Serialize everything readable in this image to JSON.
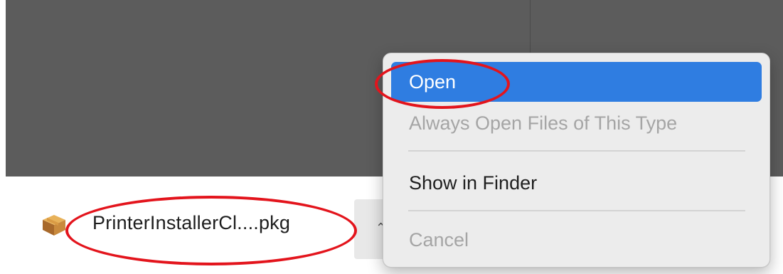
{
  "download_shelf": {
    "file_name": "PrinterInstallerCl....pkg",
    "file_icon": "package-box-icon",
    "options_icon": "chevron-up-icon"
  },
  "context_menu": {
    "items": [
      {
        "label": "Open",
        "state": "highlighted"
      },
      {
        "label": "Always Open Files of This Type",
        "state": "disabled"
      },
      {
        "label": "Show in Finder",
        "state": "enabled"
      },
      {
        "label": "Cancel",
        "state": "disabled"
      }
    ]
  },
  "annotations": {
    "ring_color": "#e3141c"
  },
  "colors": {
    "highlight": "#2f7de1",
    "content_background": "#5c5c5c",
    "menu_background": "#ececec"
  }
}
